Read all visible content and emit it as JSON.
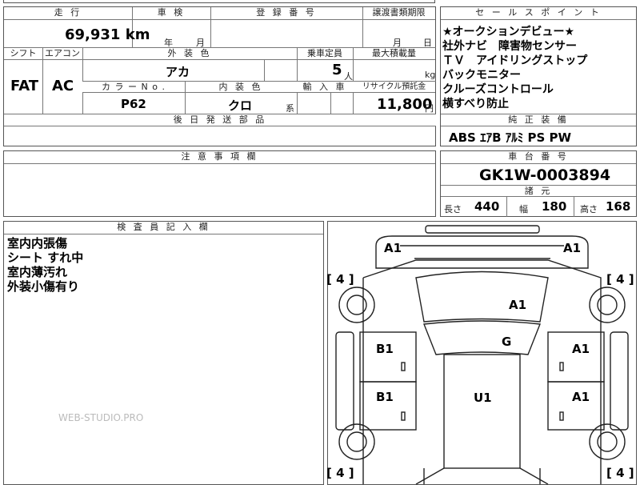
{
  "top_header": {
    "mileage_label": "走 行",
    "inspection_label": "車 検",
    "registration_label": "登 録 番 号",
    "transfer_label": "譲渡書類期限",
    "mileage_value": "69,931 km",
    "inspection_year": "年",
    "inspection_month": "月",
    "transfer_month": "月",
    "transfer_day": "日"
  },
  "row2": {
    "shift_label": "シフト",
    "ac_label": "エアコン",
    "exterior_label": "外 装 色",
    "capacity_label": "乗車定員",
    "max_load_label": "最大積載量",
    "shift_value": "FAT",
    "ac_value": "AC",
    "exterior_value": "アカ",
    "capacity_value": "5",
    "capacity_unit": "人",
    "load_unit": "kg",
    "color_no_label": "カ ラ ー  N o .",
    "interior_label": "内 装 色",
    "import_label": "輸 入 車",
    "recycle_label": "リサイクル預託金",
    "color_no_value": "P62",
    "interior_value": "クロ",
    "interior_suffix": "系",
    "recycle_value": "11,800",
    "recycle_unit": "円",
    "later_parts_label": "後 日 発 送 部 品"
  },
  "selling_points": {
    "header": "セ ー ル ス ポ イ ン ト",
    "lines": [
      "★オークションデビュー★",
      "社外ナビ　障害物センサー",
      "ＴＶ　アイドリングストップ",
      "バックモニター",
      "クルーズコントロール",
      "横すべり防止"
    ]
  },
  "equipment": {
    "header": "純 正 装 備",
    "value": "ABS  ｴｱB  ｱﾙﾐ  PS  PW"
  },
  "notes": {
    "header": "注 意 事 項 欄"
  },
  "chassis": {
    "header": "車 台 番 号",
    "value": "GK1W-0003894",
    "specs_header": "諸 元",
    "length_label": "長さ",
    "length_value": "440",
    "width_label": "幅",
    "width_value": "180",
    "height_label": "高さ",
    "height_value": "168"
  },
  "inspector": {
    "header": "検 査 員 記 入 欄",
    "lines": [
      "室内内張傷",
      "シート すれ中",
      "室内薄汚れ",
      "外装小傷有り"
    ]
  },
  "diagram": {
    "marks": {
      "front_left": "A1",
      "front_right": "A1",
      "hood": "A1",
      "windshield": "G",
      "left_front_door": "B1",
      "left_rear_door": "B1",
      "right_front_door": "A1",
      "right_rear_door": "A1",
      "roof": "U1"
    },
    "tire_tl": "[ 4 ]",
    "tire_tr": "[ 4 ]",
    "tire_bl": "[ 4 ]",
    "tire_br": "[ 4 ]"
  },
  "watermark": "WEB-STUDIO.PRO"
}
